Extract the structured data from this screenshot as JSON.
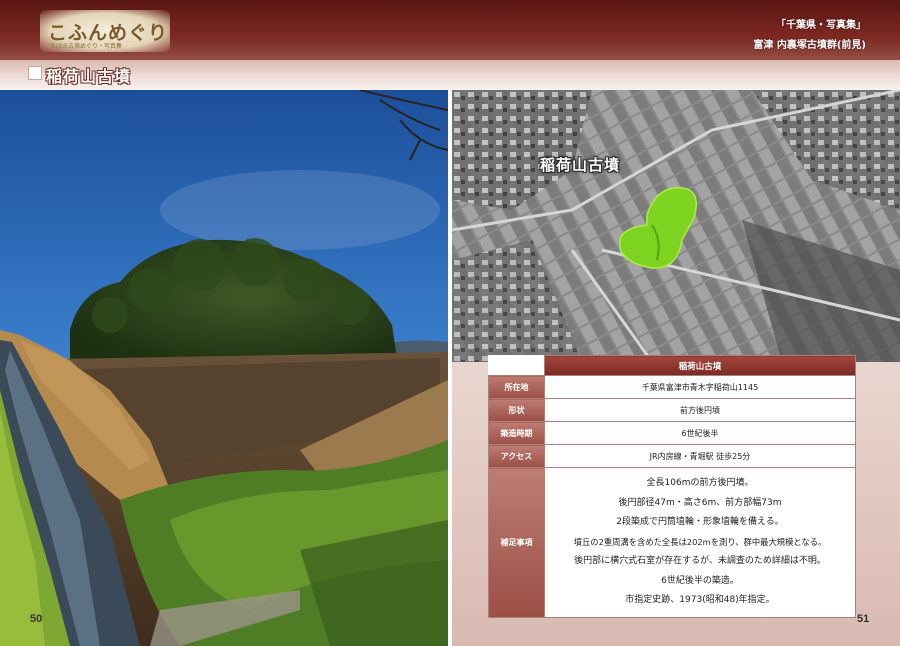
{
  "header": {
    "logo_text": "こふんめぐり",
    "logo_sub": "ちばの古墳めぐり・写真集",
    "right_line1": "「千葉県・写真集」",
    "right_line2": "富津 内裏塚古墳群(前見)"
  },
  "page": {
    "title": "稲荷山古墳",
    "left_number": "50",
    "right_number": "51"
  },
  "map": {
    "label": "稲荷山古墳"
  },
  "info_table": {
    "header": "稲荷山古墳",
    "rows": [
      {
        "label": "所在地",
        "value": "千葉県富津市青木字稲荷山1145"
      },
      {
        "label": "形状",
        "value": "前方後円墳"
      },
      {
        "label": "築造時期",
        "value": "6世紀後半"
      },
      {
        "label": "アクセス",
        "value": "JR内房線・青堀駅 徒歩25分"
      }
    ],
    "notes_label": "補足事項",
    "notes": [
      "全長106mの前方後円墳。",
      "後円部径47m・高さ6m、前方部幅73m",
      "2段築成で円筒埴輪・形象埴輪を備える。",
      "墳丘の2重周溝を含めた全長は202mを測り、群中最大規模となる。",
      "後円部に横穴式石室が存在するが、未調査のため詳細は不明。",
      "6世紀後半の築造。",
      "市指定史跡、1973(昭和48)年指定。"
    ]
  },
  "colors": {
    "header_dark": "#6a1e1a",
    "table_header": "#8c3a2f",
    "map_highlight": "#7ed321"
  }
}
